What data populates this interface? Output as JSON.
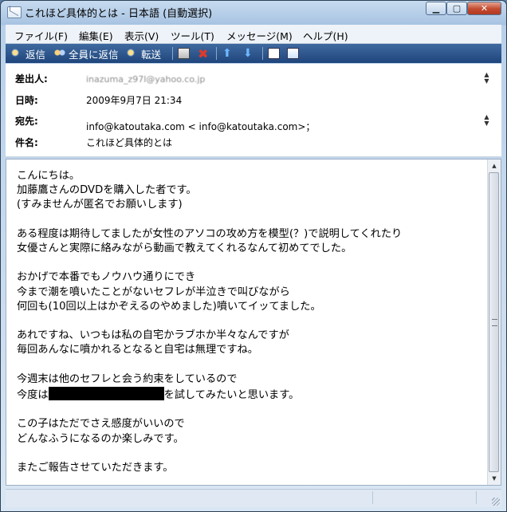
{
  "window": {
    "title": "これほど具体的とは - 日本語 (自動選択)",
    "icon": "mail-icon",
    "controls": {
      "minimize": "▁",
      "maximize": "▢",
      "close": "✕"
    }
  },
  "menu": [
    "ファイル(F)",
    "編集(E)",
    "表示(V)",
    "ツール(T)",
    "メッセージ(M)",
    "ヘルプ(H)"
  ],
  "toolbar": {
    "reply": "返信",
    "reply_all": "全員に返信",
    "forward": "転送",
    "icons": [
      "print-icon",
      "delete-icon",
      "previous-icon",
      "next-icon",
      "contact-card-icon",
      "address-book-icon"
    ]
  },
  "header": {
    "from_label": "差出人:",
    "from_value": "inazuma_z97l@yahoo.co.jp",
    "date_label": "日時:",
    "date_value": "2009年9月7日 21:34",
    "to_label": "宛先:",
    "to_value": "info@katoutaka.com < info@katoutaka.com>；",
    "subject_label": "件名:",
    "subject_value": "これほど具体的とは"
  },
  "body": {
    "lines": [
      "こんにちは。",
      "加藤鷹さんのDVDを購入した者です。",
      "(すみませんが匿名でお願いします)",
      "",
      "ある程度は期待してましたが女性のアソコの攻め方を模型(？)で説明してくれたり",
      "女優さんと実際に絡みながら動画で教えてくれるなんて初めてでした。",
      "",
      "おかげで本番でもノウハウ通りにでき",
      "今まで潮を噴いたことがないセフレが半泣きで叫びながら",
      "何回も(10回以上はかぞえるのやめました)噴いてイッてました。",
      "",
      "あれですね、いつもは私の自宅かラブホか半々なんですが",
      "毎回あんなに噴かれるとなると自宅は無理ですね。",
      "",
      "今週末は他のセフレと会う約束をしているので"
    ],
    "redacted_prefix": "今度は",
    "redacted_suffix": "を試してみたいと思います。",
    "lines_after": [
      "",
      "この子はただでさえ感度がいいので",
      "どんなふうになるのか楽しみです。",
      "",
      "またご報告させていただきます。"
    ]
  }
}
